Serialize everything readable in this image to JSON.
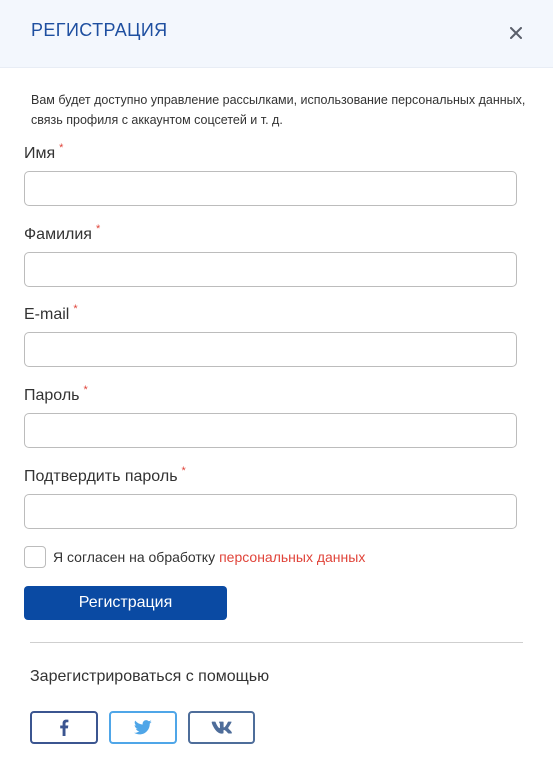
{
  "header": {
    "title": "РЕГИСТРАЦИЯ",
    "close_icon": "close-icon"
  },
  "intro": "Вам будет доступно управление рассылками, использование персональных данных, связь профиля с аккаунтом соцсетей и т. д.",
  "required_marker": "*",
  "fields": [
    {
      "label": "Имя",
      "value": "",
      "placeholder": ""
    },
    {
      "label": "Фамилия",
      "value": "",
      "placeholder": ""
    },
    {
      "label": "E-mail",
      "value": "",
      "placeholder": ""
    },
    {
      "label": "Пароль",
      "value": "",
      "placeholder": ""
    },
    {
      "label": "Подтвердить пароль",
      "value": "",
      "placeholder": ""
    }
  ],
  "consent": {
    "checked": false,
    "text": "Я согласен на обработку",
    "link": "персональных данных"
  },
  "submit_label": "Регистрация",
  "social": {
    "title": "Зарегистрироваться с помощью",
    "buttons": [
      {
        "icon": "facebook-icon",
        "color": "#3b5590"
      },
      {
        "icon": "twitter-icon",
        "color": "#4fa6e8"
      },
      {
        "icon": "vk-icon",
        "color": "#4e6d9a"
      }
    ]
  },
  "colors": {
    "accent": "#0a4aa3",
    "title": "#1e4fa0",
    "required": "#e0443a",
    "header_bg": "#f3f7fd"
  }
}
